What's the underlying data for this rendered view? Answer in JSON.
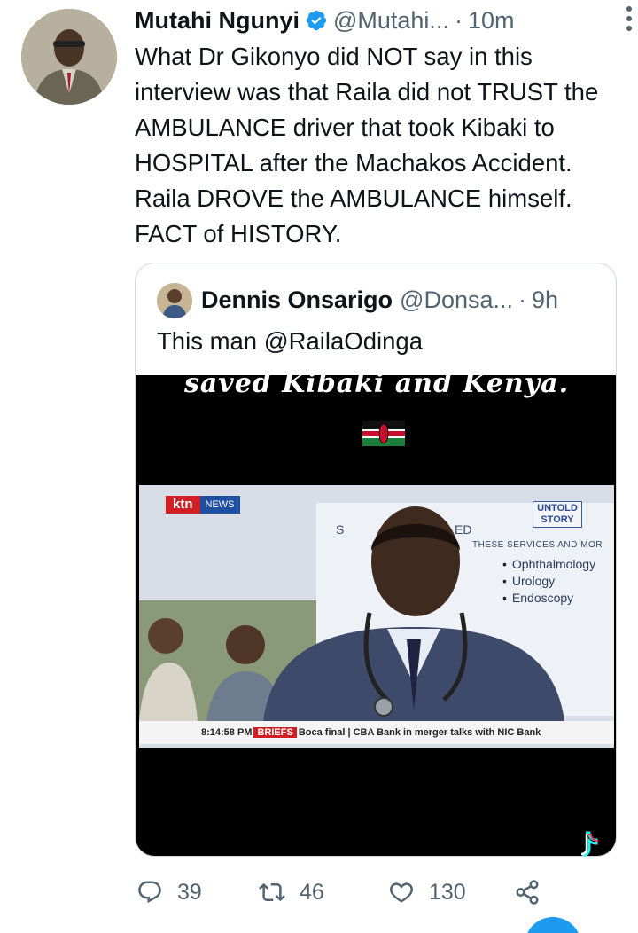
{
  "tweet": {
    "author_name": "Mutahi Ngunyi",
    "author_handle": "@Mutahi...",
    "separator": "·",
    "time": "10m",
    "text": "What Dr Gikonyo did NOT say in this interview was that Raila did not TRUST the AMBULANCE driver that took Kibaki to HOSPITAL after the Machakos Accident. Raila DROVE the AMBULANCE himself. FACT of HISTORY."
  },
  "quoted_tweet": {
    "author_name": "Dennis Onsarigo",
    "author_handle": "@Donsa...",
    "separator": "·",
    "time": "9h",
    "text": "This man @RailaOdinga"
  },
  "video": {
    "caption": "saved Kibaki and Kenya.",
    "channel_logo": "ktn",
    "channel_logo_sub": "NEWS",
    "board_heading_partial": "S",
    "board_heading_partial_2": "ED",
    "board_subheading": "THESE SERVICES AND MOR",
    "board_services": [
      "Ophthalmology",
      "Urology",
      "Endoscopy"
    ],
    "program_logo_line1": "UNTOLD",
    "program_logo_line2": "STORY",
    "ticker_time": "8:14:58 PM",
    "ticker_label": "BRIEFS",
    "ticker_text": "Boca final  |  CBA Bank in merger talks with NIC Bank"
  },
  "actions": {
    "replies": "39",
    "retweets": "46",
    "likes": "130"
  },
  "colors": {
    "accent": "#1d9bf0",
    "secondary_text": "#536471",
    "primary_text": "#0f1419",
    "border": "#cfd9de"
  },
  "icons": [
    "verified-badge-icon",
    "more-options-icon",
    "reply-icon",
    "retweet-icon",
    "like-icon",
    "share-icon",
    "tiktok-icon",
    "kenya-flag-icon"
  ]
}
